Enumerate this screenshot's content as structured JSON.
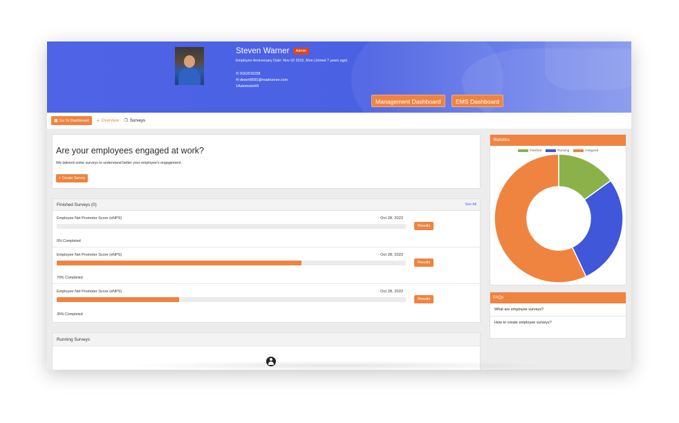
{
  "header": {
    "name": "Steven Warner",
    "badge": "Admin",
    "anniversary": "Employee Anniversary Date: Nov 02 2015, Mon (Joined 7 years ago)",
    "phone": "9162016258",
    "email": "desert9091@roadrunner.com",
    "company": "1AutomotoHR",
    "management_button": "Management Dashboard",
    "ems_button": "EMS Dashboard"
  },
  "toolbar": {
    "dashboard_button": "Go To Dashboard",
    "overview_tab": "Overview",
    "surveys_tab": "Surveys"
  },
  "hero": {
    "title": "Are your employees engaged at work?",
    "subtitle": "We tailored some surveys to understand better your employee's engagement.",
    "create_button": "Create Survey"
  },
  "finished": {
    "title": "Finished Surveys (0)",
    "see_all": "See All",
    "results_label": "Results",
    "rows": [
      {
        "name": "Employee Net Promoter Score (eNPS)",
        "date": "Oct 28, 2022",
        "progress": 0,
        "completed": "0% Completed"
      },
      {
        "name": "Employee Net Promoter Score (eNPS)",
        "date": "Oct 28, 2022",
        "progress": 70,
        "completed": "70% Completed"
      },
      {
        "name": "Employee Net Promoter Score (eNPS)",
        "date": "Oct 28, 2022",
        "progress": 35,
        "completed": "35% Completed"
      }
    ]
  },
  "running": {
    "title": "Running Surveys"
  },
  "stats": {
    "title": "Statistics"
  },
  "chart_data": {
    "type": "pie",
    "title": "",
    "categories": [
      "Finished",
      "Running",
      "Assigned"
    ],
    "values": [
      15,
      28,
      57
    ],
    "colors": [
      "#8bb24a",
      "#3f57d8",
      "#ee8440"
    ],
    "legend": "top"
  },
  "faqs": {
    "title": "FAQs",
    "items": [
      "What are employee surveys?",
      "How to create employee surveys?"
    ]
  }
}
